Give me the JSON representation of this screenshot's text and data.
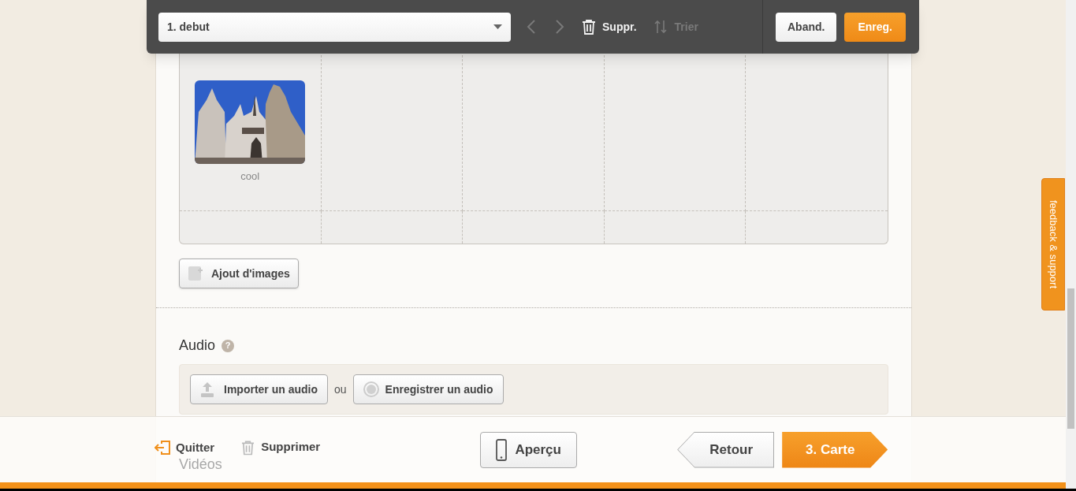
{
  "toolbar": {
    "slide_select": {
      "value": "1. debut"
    },
    "prev": {
      "disabled": true
    },
    "next": {
      "disabled": true
    },
    "delete": {
      "label": "Suppr.",
      "disabled": false
    },
    "sort": {
      "label": "Trier",
      "disabled": true
    },
    "cancel": "Aband.",
    "save": "Enreg."
  },
  "images": [
    {
      "kind": "picture",
      "caption": "cool"
    }
  ],
  "add_images_button": "Ajout d'images",
  "audio": {
    "title": "Audio",
    "help": "?",
    "import_button": "Importer un audio",
    "or": "ou",
    "record_button": "Enregistrer un audio"
  },
  "videos": {
    "title": "Vidéos"
  },
  "footer": {
    "quit": "Quitter",
    "delete": "Supprimer",
    "preview": "Aperçu",
    "back": "Retour",
    "next": "3. Carte"
  },
  "feedback_tab": "feedback & support"
}
